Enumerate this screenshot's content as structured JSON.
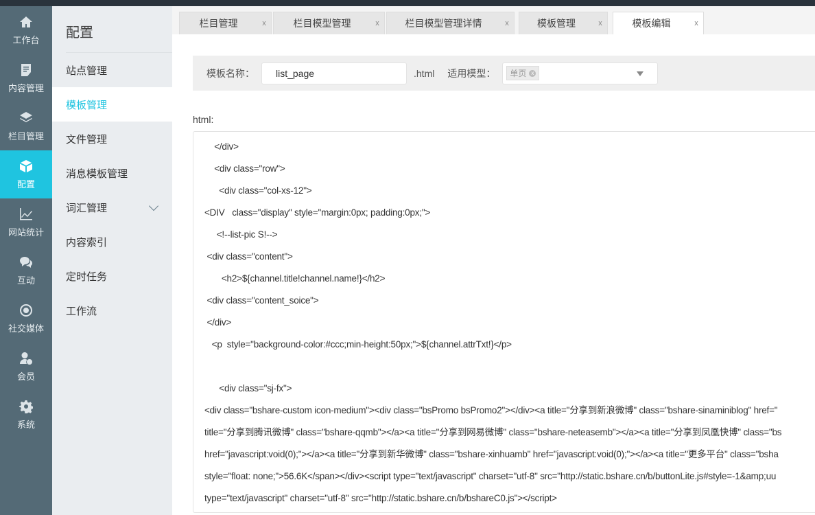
{
  "nav": [
    {
      "label": "工作台",
      "icon": "home-icon"
    },
    {
      "label": "内容管理",
      "icon": "document-icon"
    },
    {
      "label": "栏目管理",
      "icon": "layers-icon"
    },
    {
      "label": "配置",
      "icon": "cube-icon",
      "active": true
    },
    {
      "label": "网站统计",
      "icon": "chart-icon"
    },
    {
      "label": "互动",
      "icon": "chat-icon"
    },
    {
      "label": "社交媒体",
      "icon": "social-icon"
    },
    {
      "label": "会员",
      "icon": "user-icon"
    },
    {
      "label": "系统",
      "icon": "gear-icon"
    }
  ],
  "submenu": {
    "title": "配置",
    "items": [
      "站点管理",
      "模板管理",
      "文件管理",
      "消息模板管理",
      "词汇管理",
      "内容索引",
      "定时任务",
      "工作流"
    ],
    "active_index": 1
  },
  "tabs": [
    {
      "label": "栏目管理",
      "close": "x"
    },
    {
      "label": "栏目模型管理",
      "close": "x"
    },
    {
      "label": "栏目模型管理详情",
      "close": "x"
    },
    {
      "label": "模板管理",
      "close": "x"
    },
    {
      "label": "模板编辑",
      "close": "x",
      "active": true
    }
  ],
  "form": {
    "name_label": "模板名称：",
    "name_value": "list_page",
    "suffix": ".html",
    "model_label": "适用模型：",
    "model_chip": "单页",
    "chip_close": "x"
  },
  "editor": {
    "label": "html:",
    "lines": [
      "    </div>",
      "    <div class=\"row\">",
      "      <div class=\"col-xs-12\">",
      "<DIV   class=\"display\" style=\"margin:0px; padding:0px;\">",
      "     <!--list-pic S!-->",
      " <div class=\"content\">",
      "       <h2>${channel.title!channel.name!}</h2>",
      " <div class=\"content_soice\">",
      " </div>",
      "   <p  style=\"background-color:#ccc;min-height:50px;\">${channel.attrTxt!}</p>",
      "",
      "      <div class=\"sj-fx\">",
      "<div class=\"bshare-custom icon-medium\"><div class=\"bsPromo bsPromo2\"></div><a title=\"分享到新浪微博\" class=\"bshare-sinaminiblog\" href=\"",
      "title=\"分享到腾讯微博\" class=\"bshare-qqmb\"></a><a title=\"分享到网易微博\" class=\"bshare-neteasemb\"></a><a title=\"分享到凤凰快博\" class=\"bs",
      "href=\"javascript:void(0);\"></a><a title=\"分享到新华微博\" class=\"bshare-xinhuamb\" href=\"javascript:void(0);\"></a><a title=\"更多平台\" class=\"bsha",
      "style=\"float: none;\">56.6K</span></div><script type=\"text/javascript\" charset=\"utf-8\" src=\"http://static.bshare.cn/b/buttonLite.js#style=-1&amp;uu",
      "type=\"text/javascript\" charset=\"utf-8\" src=\"http://static.bshare.cn/b/bshareC0.js\"></script>"
    ]
  },
  "colors": {
    "accent": "#1fc4e0",
    "nav_bg": "#546a76",
    "sub_bg": "#eaedf0"
  }
}
